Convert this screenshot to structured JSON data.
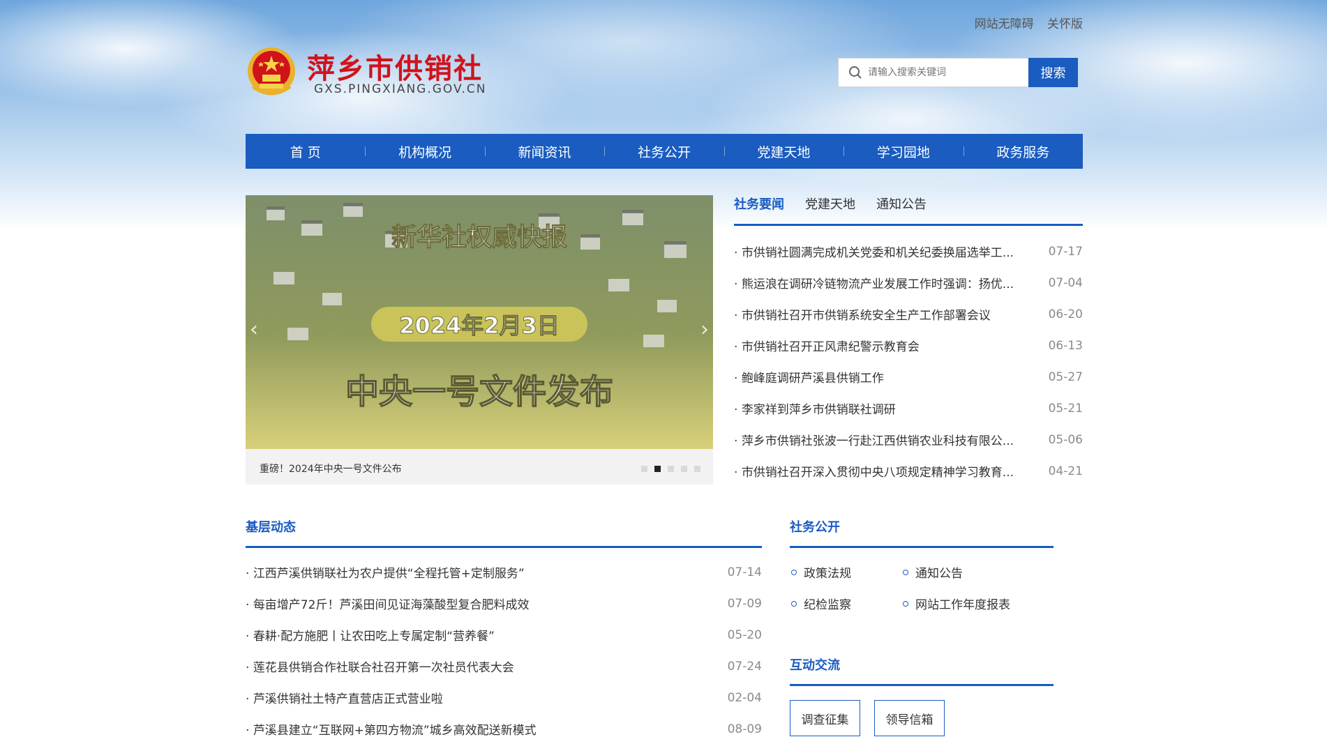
{
  "top_links": [
    "网站无障碍",
    "关怀版"
  ],
  "site": {
    "title": "萍乡市供销社",
    "domain": "GXS.PINGXIANG.GOV.CN"
  },
  "search": {
    "placeholder": "请输入搜索关键词",
    "button": "搜索"
  },
  "nav": [
    "首 页",
    "机构概况",
    "新闻资讯",
    "社务公开",
    "党建天地",
    "学习园地",
    "政务服务"
  ],
  "slider": {
    "image_text": {
      "line1": "新华社权威快报",
      "line2": "2024年2月3日",
      "line3": "中央一号文件发布"
    },
    "caption": "重磅！2024年中央一号文件公布",
    "dot_count": 5,
    "active_dot": 2,
    "prev": "‹",
    "next": "›"
  },
  "news_tabs": [
    "社务要闻",
    "党建天地",
    "通知公告"
  ],
  "news_items": [
    {
      "title": "市供销社圆满完成机关党委和机关纪委换届选举工...",
      "date": "07-17"
    },
    {
      "title": "熊运浪在调研冷链物流产业发展工作时强调：扬优...",
      "date": "07-04"
    },
    {
      "title": "市供销社召开市供销系统安全生产工作部署会议",
      "date": "06-20"
    },
    {
      "title": "市供销社召开正风肃纪警示教育会",
      "date": "06-13"
    },
    {
      "title": "鲍峰庭调研芦溪县供销工作",
      "date": "05-27"
    },
    {
      "title": "李家祥到萍乡市供销联社调研",
      "date": "05-21"
    },
    {
      "title": "萍乡市供销社张波一行赴江西供销农业科技有限公...",
      "date": "05-06"
    },
    {
      "title": "市供销社召开深入贯彻中央八项规定精神学习教育...",
      "date": "04-21"
    }
  ],
  "base_section": {
    "title": "基层动态",
    "items": [
      {
        "title": "江西芦溪供销联社为农户提供“全程托管+定制服务”",
        "date": "07-14"
      },
      {
        "title": "每亩增产72斤！芦溪田间见证海藻酸型复合肥料成效",
        "date": "07-09"
      },
      {
        "title": "春耕·配方施肥丨让农田吃上专属定制“营养餐”",
        "date": "05-20"
      },
      {
        "title": "莲花县供销合作社联合社召开第一次社员代表大会",
        "date": "07-24"
      },
      {
        "title": "芦溪供销社土特产直营店正式营业啦",
        "date": "02-04"
      },
      {
        "title": "芦溪县建立“互联网+第四方物流”城乡高效配送新模式",
        "date": "08-09"
      }
    ]
  },
  "open_section": {
    "title": "社务公开",
    "items": [
      "政策法规",
      "通知公告",
      "纪检监察",
      "网站工作年度报表"
    ]
  },
  "interact_section": {
    "title": "互动交流",
    "buttons": [
      "调查征集",
      "领导信箱"
    ]
  },
  "colors": {
    "brand_blue": "#1a5cc0",
    "title_red": "#d1121b"
  }
}
